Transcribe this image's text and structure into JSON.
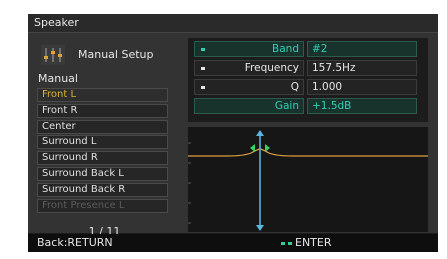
{
  "window": {
    "title": "Speaker"
  },
  "setup": {
    "title": "Manual Setup",
    "icon": "eq-sliders-icon"
  },
  "mode_label": "Manual",
  "channels": [
    {
      "label": "Front L",
      "state": "selected"
    },
    {
      "label": "Front R",
      "state": "normal"
    },
    {
      "label": "Center",
      "state": "normal"
    },
    {
      "label": "Surround L",
      "state": "normal"
    },
    {
      "label": "Surround R",
      "state": "normal"
    },
    {
      "label": "Surround Back L",
      "state": "normal"
    },
    {
      "label": "Surround Back R",
      "state": "normal"
    },
    {
      "label": "Front Presence L",
      "state": "disabled"
    }
  ],
  "page": {
    "indicator": "1 / 11"
  },
  "params": {
    "band": {
      "label": "Band",
      "value": "#2"
    },
    "frequency": {
      "label": "Frequency",
      "value": "157.5Hz"
    },
    "q": {
      "label": "Q",
      "value": "1.000"
    },
    "gain": {
      "label": "Gain",
      "value": "+1.5dB"
    }
  },
  "footer": {
    "back": "Back:RETURN",
    "enter": "ENTER"
  },
  "colors": {
    "highlight": "#2fd0b8",
    "selected_channel": "#e0b030",
    "curve": "#e0a040",
    "cursor": "#5ab8e0",
    "adjust_arrows": "#3ad060"
  }
}
